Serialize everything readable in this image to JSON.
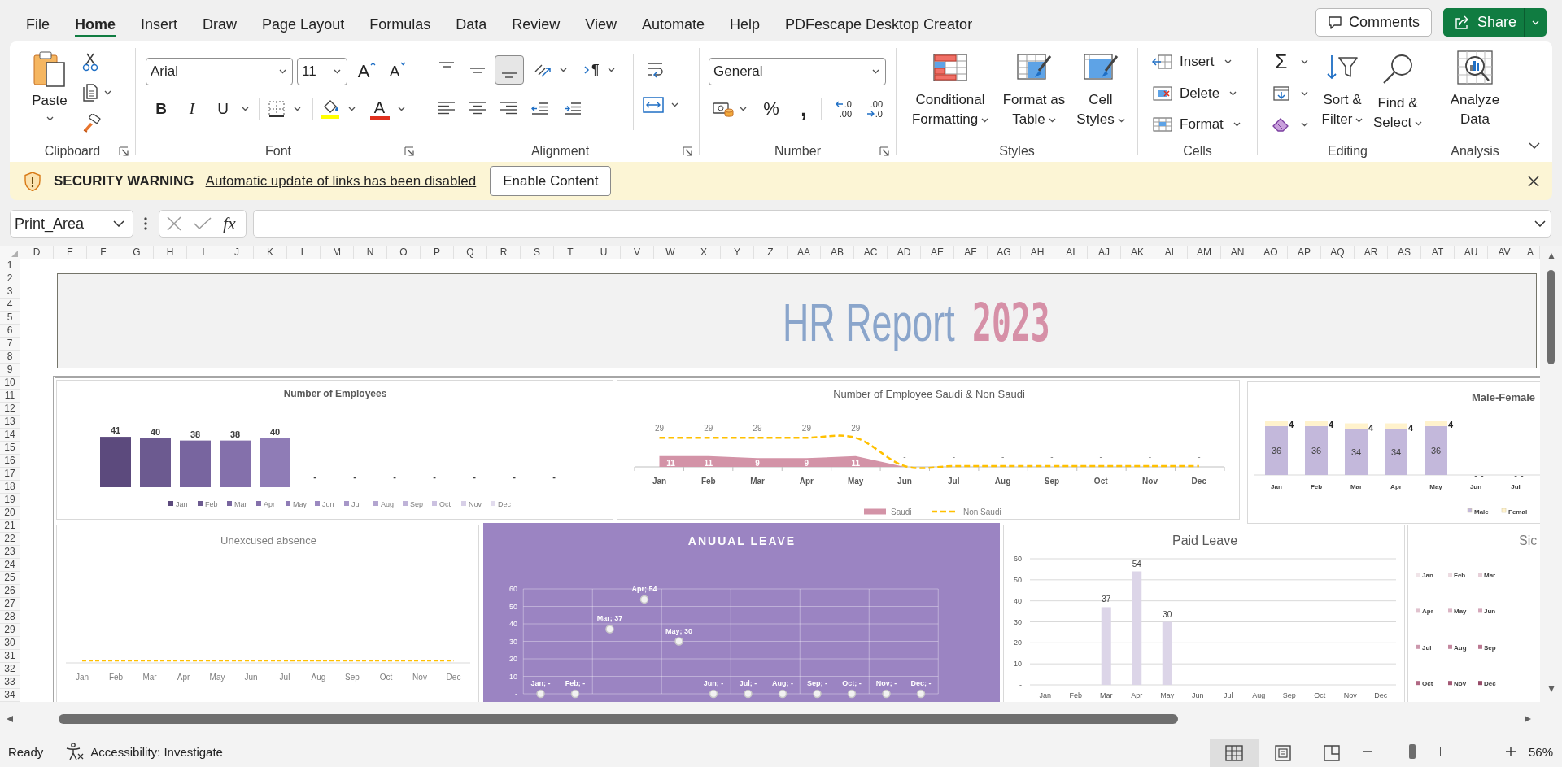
{
  "tabs": [
    {
      "label": "File",
      "selected": false
    },
    {
      "label": "Home",
      "selected": true
    },
    {
      "label": "Insert",
      "selected": false
    },
    {
      "label": "Draw",
      "selected": false
    },
    {
      "label": "Page Layout",
      "selected": false
    },
    {
      "label": "Formulas",
      "selected": false
    },
    {
      "label": "Data",
      "selected": false
    },
    {
      "label": "Review",
      "selected": false
    },
    {
      "label": "View",
      "selected": false
    },
    {
      "label": "Automate",
      "selected": false
    },
    {
      "label": "Help",
      "selected": false
    },
    {
      "label": "PDFescape Desktop Creator",
      "selected": false
    }
  ],
  "title_bar_buttons": {
    "comments": "Comments",
    "share": "Share"
  },
  "ribbon": {
    "clipboard": {
      "title": "Clipboard",
      "paste": "Paste"
    },
    "font": {
      "title": "Font",
      "font_name": "Arial",
      "font_size": "11",
      "grow": "A",
      "shrink": "A",
      "bold": "B",
      "italic": "I",
      "underline": "U",
      "font_color": "A"
    },
    "alignment": {
      "title": "Alignment",
      "vertical_align": [
        {
          "on": false
        },
        {
          "on": false
        },
        {
          "on": true
        }
      ],
      "direction": "¶"
    },
    "number": {
      "title": "Number",
      "format": "General",
      "percent": "%",
      "comma": ",",
      "increase_decimal": [
        ".0",
        ".00"
      ],
      "decrease_decimal": [
        ".00",
        ".0"
      ]
    },
    "styles": {
      "title": "Styles",
      "buttons": [
        "Conditional Formatting",
        "Format as Table",
        "Cell Styles"
      ]
    },
    "cells": {
      "title": "Cells",
      "buttons": [
        "Insert",
        "Delete",
        "Format"
      ]
    },
    "editing": {
      "title": "Editing",
      "autosum": "Σ",
      "buttons": [
        "Sort & Filter",
        "Find & Select"
      ]
    },
    "analysis": {
      "title": "Analysis",
      "button": "Analyze Data"
    }
  },
  "security_bar": {
    "title": "SECURITY WARNING",
    "message": "Automatic update of links has been disabled",
    "button": "Enable Content"
  },
  "formula_bar": {
    "name_box": "Print_Area",
    "function_button": "fx"
  },
  "sheet": {
    "columns": [
      "D",
      "E",
      "F",
      "G",
      "H",
      "I",
      "J",
      "K",
      "L",
      "M",
      "N",
      "O",
      "P",
      "Q",
      "R",
      "S",
      "T",
      "U",
      "V",
      "W",
      "X",
      "Y",
      "Z",
      "AA",
      "AB",
      "AC",
      "AD",
      "AE",
      "AF",
      "AG",
      "AH",
      "AI",
      "AJ",
      "AK",
      "AL",
      "AM",
      "AN",
      "AO",
      "AP",
      "AQ",
      "AR",
      "AS",
      "AT",
      "AU",
      "AV",
      "A"
    ],
    "rows": [
      "1",
      "2",
      "3",
      "4",
      "5",
      "6",
      "7",
      "8",
      "9",
      "10",
      "11",
      "12",
      "13",
      "14",
      "15",
      "16",
      "17",
      "18",
      "19",
      "20",
      "21",
      "22",
      "23",
      "24",
      "25",
      "26",
      "27",
      "28",
      "29",
      "30",
      "31",
      "32",
      "33",
      "34"
    ]
  },
  "dashboard": {
    "title": "HR Report",
    "year": "2023",
    "employees_chart": {
      "chart_data": {
        "type": "bar",
        "title": "Number of Employees",
        "categories": [
          null
        ],
        "series": [
          {
            "name": "Jan",
            "color": "#5c4a7d",
            "values": [
              41
            ],
            "value_labels": [
              "41"
            ]
          },
          {
            "name": "Feb",
            "color": "#6c5a90",
            "values": [
              40
            ],
            "value_labels": [
              "40"
            ]
          },
          {
            "name": "Mar",
            "color": "#78659f",
            "values": [
              38
            ],
            "value_labels": [
              "38"
            ]
          },
          {
            "name": "Apr",
            "color": "#8470ab",
            "values": [
              38
            ],
            "value_labels": [
              "38"
            ]
          },
          {
            "name": "May",
            "color": "#8f7cb6",
            "values": [
              40
            ],
            "value_labels": [
              "40"
            ]
          },
          {
            "name": "Jun",
            "color": "#9b89c0",
            "values": [
              null
            ],
            "value_labels": [
              "-"
            ]
          },
          {
            "name": "Jul",
            "color": "#a797c8",
            "values": [
              null
            ],
            "value_labels": [
              "-"
            ]
          },
          {
            "name": "Aug",
            "color": "#b3a5d0",
            "values": [
              null
            ],
            "value_labels": [
              "-"
            ]
          },
          {
            "name": "Sep",
            "color": "#bfb3d8",
            "values": [
              null
            ],
            "value_labels": [
              "-"
            ]
          },
          {
            "name": "Oct",
            "color": "#cbc1e0",
            "values": [
              null
            ],
            "value_labels": [
              "-"
            ]
          },
          {
            "name": "Nov",
            "color": "#d7cfe7",
            "values": [
              null
            ],
            "value_labels": [
              "-"
            ]
          },
          {
            "name": "Dec",
            "color": "#e2dcee",
            "values": [
              null
            ],
            "value_labels": [
              "-"
            ]
          }
        ],
        "legend": "bottom"
      }
    },
    "nationality_chart": {
      "chart_data": {
        "type": "area",
        "title": "Number of Employee Saudi & Non Saudi",
        "categories": [
          "Jan",
          "Feb",
          "Mar",
          "Apr",
          "May",
          "Jun",
          "Jul",
          "Aug",
          "Sep",
          "Oct",
          "Nov",
          "Dec"
        ],
        "series": [
          {
            "name": "Saudi",
            "color": "#d393a7",
            "values": [
              11,
              11,
              9,
              9,
              11,
              0,
              0,
              0,
              0,
              0,
              0,
              0
            ],
            "value_labels": [
              "11",
              "11",
              "9",
              "9",
              "11",
              null,
              null,
              null,
              null,
              null,
              null,
              null
            ]
          },
          {
            "name": "Non Saudi",
            "type": "line",
            "line_style": "dashed",
            "color": "#ffc000",
            "values": [
              29,
              29,
              29,
              29,
              29,
              0,
              0,
              0,
              0,
              0,
              0,
              0
            ],
            "value_labels": [
              "29",
              "29",
              "29",
              "29",
              "29",
              "-",
              "-",
              "-",
              "-",
              "-",
              "-",
              "-"
            ]
          }
        ],
        "legend": "bottom"
      }
    },
    "gender_chart": {
      "chart_data": {
        "type": "bar",
        "stacked": true,
        "title": "Male-Female",
        "categories": [
          "Jan",
          "Feb",
          "Mar",
          "Apr",
          "May",
          "Jun",
          "Jul"
        ],
        "series": [
          {
            "name": "Male",
            "color": "#c3b8db",
            "values": [
              36,
              36,
              34,
              34,
              36,
              0,
              0
            ],
            "value_labels": [
              "36",
              "36",
              "34",
              "34",
              "36",
              "-",
              "-"
            ]
          },
          {
            "name": "Femal",
            "color": "#fff2cc",
            "values": [
              4,
              4,
              4,
              4,
              4,
              0,
              0
            ],
            "value_labels": [
              "4",
              "4",
              "4",
              "4",
              "4",
              "-",
              "-"
            ]
          }
        ],
        "legend": "bottom"
      }
    },
    "absence_chart": {
      "title": "Unexcused absence",
      "axis_labels": [
        "Jan",
        "Feb",
        "Mar",
        "Apr",
        "May",
        "Jun",
        "Jul",
        "Aug",
        "Sep",
        "Oct",
        "Nov",
        "Dec"
      ],
      "point_labels": [
        "-",
        "-",
        "-",
        "-",
        "-",
        "-",
        "-",
        "-",
        "-",
        "-",
        "-",
        "-"
      ]
    },
    "annual_leave_chart": {
      "chart_data": {
        "type": "scatter",
        "title": "ANUUAL LEAVE",
        "categories": [
          null,
          null,
          null,
          null,
          null,
          null,
          null,
          null,
          null,
          null,
          null,
          null
        ],
        "values": [
          0,
          0,
          37,
          54,
          30,
          0,
          0,
          0,
          0,
          0,
          0,
          0
        ],
        "value_labels": [
          "Jan; -",
          "Feb; -",
          "Mar; 37",
          "Apr; 54",
          "May; 30",
          "Jun; -",
          "Jul; -",
          "Aug; -",
          "Sep; -",
          "Oct; -",
          "Nov; -",
          "Dec; -"
        ],
        "ylim": [
          0,
          60
        ],
        "yticks": [
          {
            "value": 0,
            "label": "-"
          },
          10,
          20,
          30,
          40,
          50,
          60
        ],
        "grid": true
      }
    },
    "paid_leave_chart": {
      "chart_data": {
        "type": "bar",
        "title": "Paid Leave",
        "categories": [
          "Jan",
          "Feb",
          "Mar",
          "Apr",
          "May",
          "Jun",
          "Jul",
          "Aug",
          "Sep",
          "Oct",
          "Nov",
          "Dec"
        ],
        "values": [
          0,
          0,
          37,
          54,
          30,
          0,
          0,
          0,
          0,
          0,
          0,
          0
        ],
        "value_labels": [
          "-",
          "-",
          "37",
          "54",
          "30",
          "-",
          "-",
          "-",
          "-",
          "-",
          "-",
          "-"
        ],
        "ylim": [
          0,
          60
        ],
        "yticks": [
          {
            "value": 0,
            "label": "-"
          },
          10,
          20,
          30,
          40,
          50,
          60
        ],
        "grid": true
      }
    },
    "sick_chart": {
      "title": "Sic",
      "legend": [
        {
          "label": "Jan",
          "color": "#f0e4e8"
        },
        {
          "label": "Feb",
          "color": "#ecdbe1"
        },
        {
          "label": "Mar",
          "color": "#e6cfd8"
        },
        {
          "label": "Apr",
          "color": "#e0c2ce"
        },
        {
          "label": "May",
          "color": "#dab5c4"
        },
        {
          "label": "Jun",
          "color": "#d4a8ba"
        },
        {
          "label": "Jul",
          "color": "#cc98ad"
        },
        {
          "label": "Aug",
          "color": "#c4889f"
        },
        {
          "label": "Sep",
          "color": "#bb7891"
        },
        {
          "label": "Oct",
          "color": "#b06883"
        },
        {
          "label": "Nov",
          "color": "#a45975"
        },
        {
          "label": "Dec",
          "color": "#974b68"
        }
      ]
    }
  },
  "status_bar": {
    "status": "Ready",
    "accessibility": "Accessibility: Investigate",
    "views": [
      {
        "selected": true
      },
      {
        "selected": false
      },
      {
        "selected": false
      }
    ],
    "zoom": {
      "level": 0.27,
      "value": "56%"
    }
  }
}
